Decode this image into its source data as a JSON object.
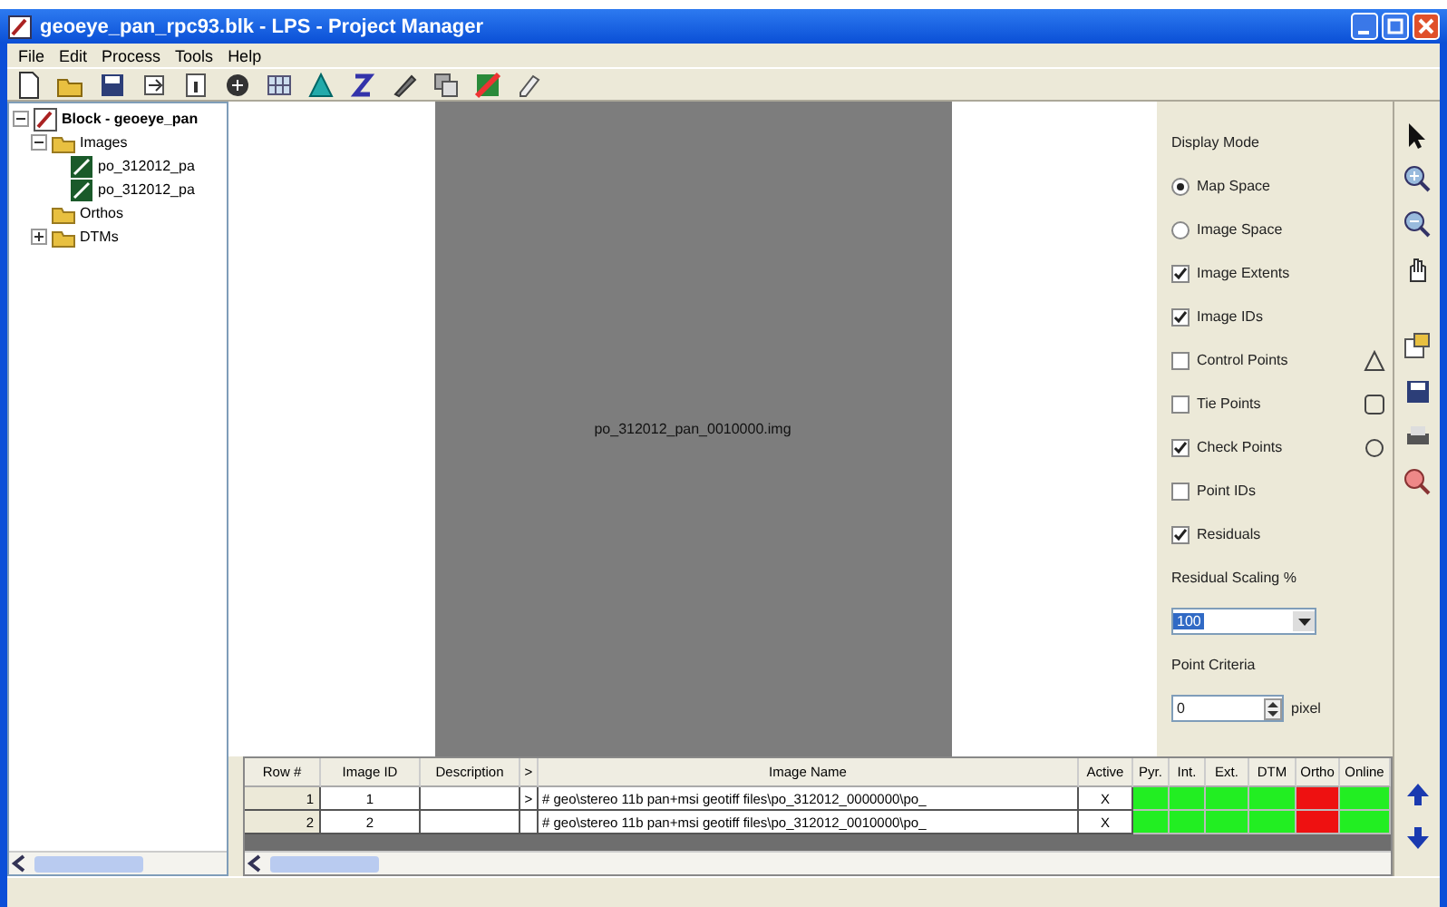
{
  "window": {
    "title": "geoeye_pan_rpc93.blk - LPS - Project Manager"
  },
  "menu": [
    "File",
    "Edit",
    "Process",
    "Tools",
    "Help"
  ],
  "tree": [
    {
      "label": "Block - geoeye_pan",
      "kind": "block",
      "expanded": true,
      "children": [
        {
          "label": "Images",
          "kind": "folder",
          "expanded": true,
          "children": [
            {
              "label": "po_312012_pa",
              "kind": "image"
            },
            {
              "label": "po_312012_pa",
              "kind": "image"
            }
          ]
        },
        {
          "label": "Orthos",
          "kind": "folder"
        },
        {
          "label": "DTMs",
          "kind": "folder",
          "expanded": false
        }
      ]
    }
  ],
  "canvas": {
    "image_label": "po_312012_pan_0010000.img"
  },
  "display_panel": [
    {
      "kind": "heading",
      "label": "Display Mode"
    },
    {
      "kind": "radio",
      "label": "Map Space",
      "selected": true
    },
    {
      "kind": "radio",
      "label": "Image Space",
      "selected": false
    },
    {
      "kind": "checkbox",
      "label": "Image Extents",
      "checked": true
    },
    {
      "kind": "checkbox",
      "label": "Image IDs",
      "checked": true
    },
    {
      "kind": "checkbox",
      "label": "Control Points",
      "checked": false,
      "symbol": true
    },
    {
      "kind": "checkbox",
      "label": "Tie Points",
      "checked": false,
      "symbol": true
    },
    {
      "kind": "checkbox",
      "label": "Check Points",
      "checked": true,
      "symbol": true
    },
    {
      "kind": "checkbox",
      "label": "Point IDs",
      "checked": false
    },
    {
      "kind": "checkbox",
      "label": "Residuals",
      "checked": true
    },
    {
      "kind": "heading",
      "label": "Residual Scaling %"
    },
    {
      "kind": "dropdown",
      "value": "100",
      "highlighted": true
    },
    {
      "kind": "heading",
      "label": "Point Criteria"
    },
    {
      "kind": "spinner",
      "value": "0",
      "unit": "pixel"
    }
  ],
  "table": {
    "columns": [
      "Row #",
      "Image ID",
      "Description",
      ">",
      "Image Name",
      "Active",
      "Pyr.",
      "Int.",
      "Ext.",
      "DTM",
      "Ortho",
      "Online"
    ],
    "rows": [
      {
        "row": "1",
        "image_id": "1",
        "marker": ">",
        "image_name": "# geo\\stereo 11b pan+msi geotiff files\\po_312012_0000000\\po_",
        "active": "X",
        "stages": [
          {
            "color": "#22ee22"
          },
          {
            "color": "#22ee22"
          },
          {
            "color": "#22ee22"
          },
          {
            "color": "#22ee22"
          },
          {
            "color": "#ee1111"
          },
          {
            "color": "#22ee22"
          }
        ]
      },
      {
        "row": "2",
        "image_id": "2",
        "image_name": "# geo\\stereo 11b pan+msi geotiff files\\po_312012_0010000\\po_",
        "active": "X",
        "stages": [
          {
            "color": "#22ee22"
          },
          {
            "color": "#22ee22"
          },
          {
            "color": "#22ee22"
          },
          {
            "color": "#22ee22"
          },
          {
            "color": "#ee1111"
          },
          {
            "color": "#22ee22"
          }
        ]
      }
    ]
  }
}
